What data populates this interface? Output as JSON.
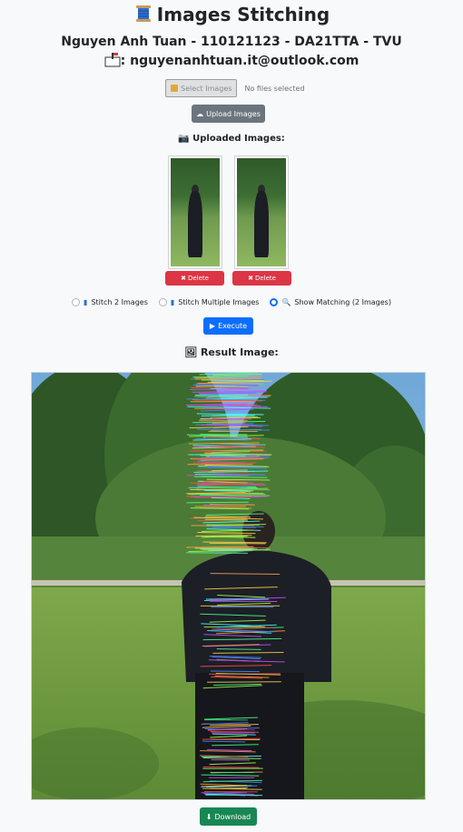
{
  "header": {
    "title": "Images Stitching",
    "author": "Nguyen Anh Tuan - 110121123 - DA21TTA - TVU",
    "email": ": nguyenanhtuan.it@outlook.com"
  },
  "upload": {
    "select_label": "Select Images",
    "no_files": "No files selected",
    "upload_label": "Upload Images"
  },
  "uploaded": {
    "label": "Uploaded Images:",
    "delete_label": "Delete"
  },
  "modes": [
    {
      "label": "Stitch 2 Images",
      "checked": false
    },
    {
      "label": "Stitch Multiple Images",
      "checked": false
    },
    {
      "label": "Show Matching (2 Images)",
      "checked": true
    }
  ],
  "execute_label": "Execute",
  "result_label": "Result Image:",
  "download_label": "Download",
  "colors": {
    "primary": "#0d6efd",
    "danger": "#dc3545",
    "secondary": "#6c757d",
    "success": "#198754"
  }
}
